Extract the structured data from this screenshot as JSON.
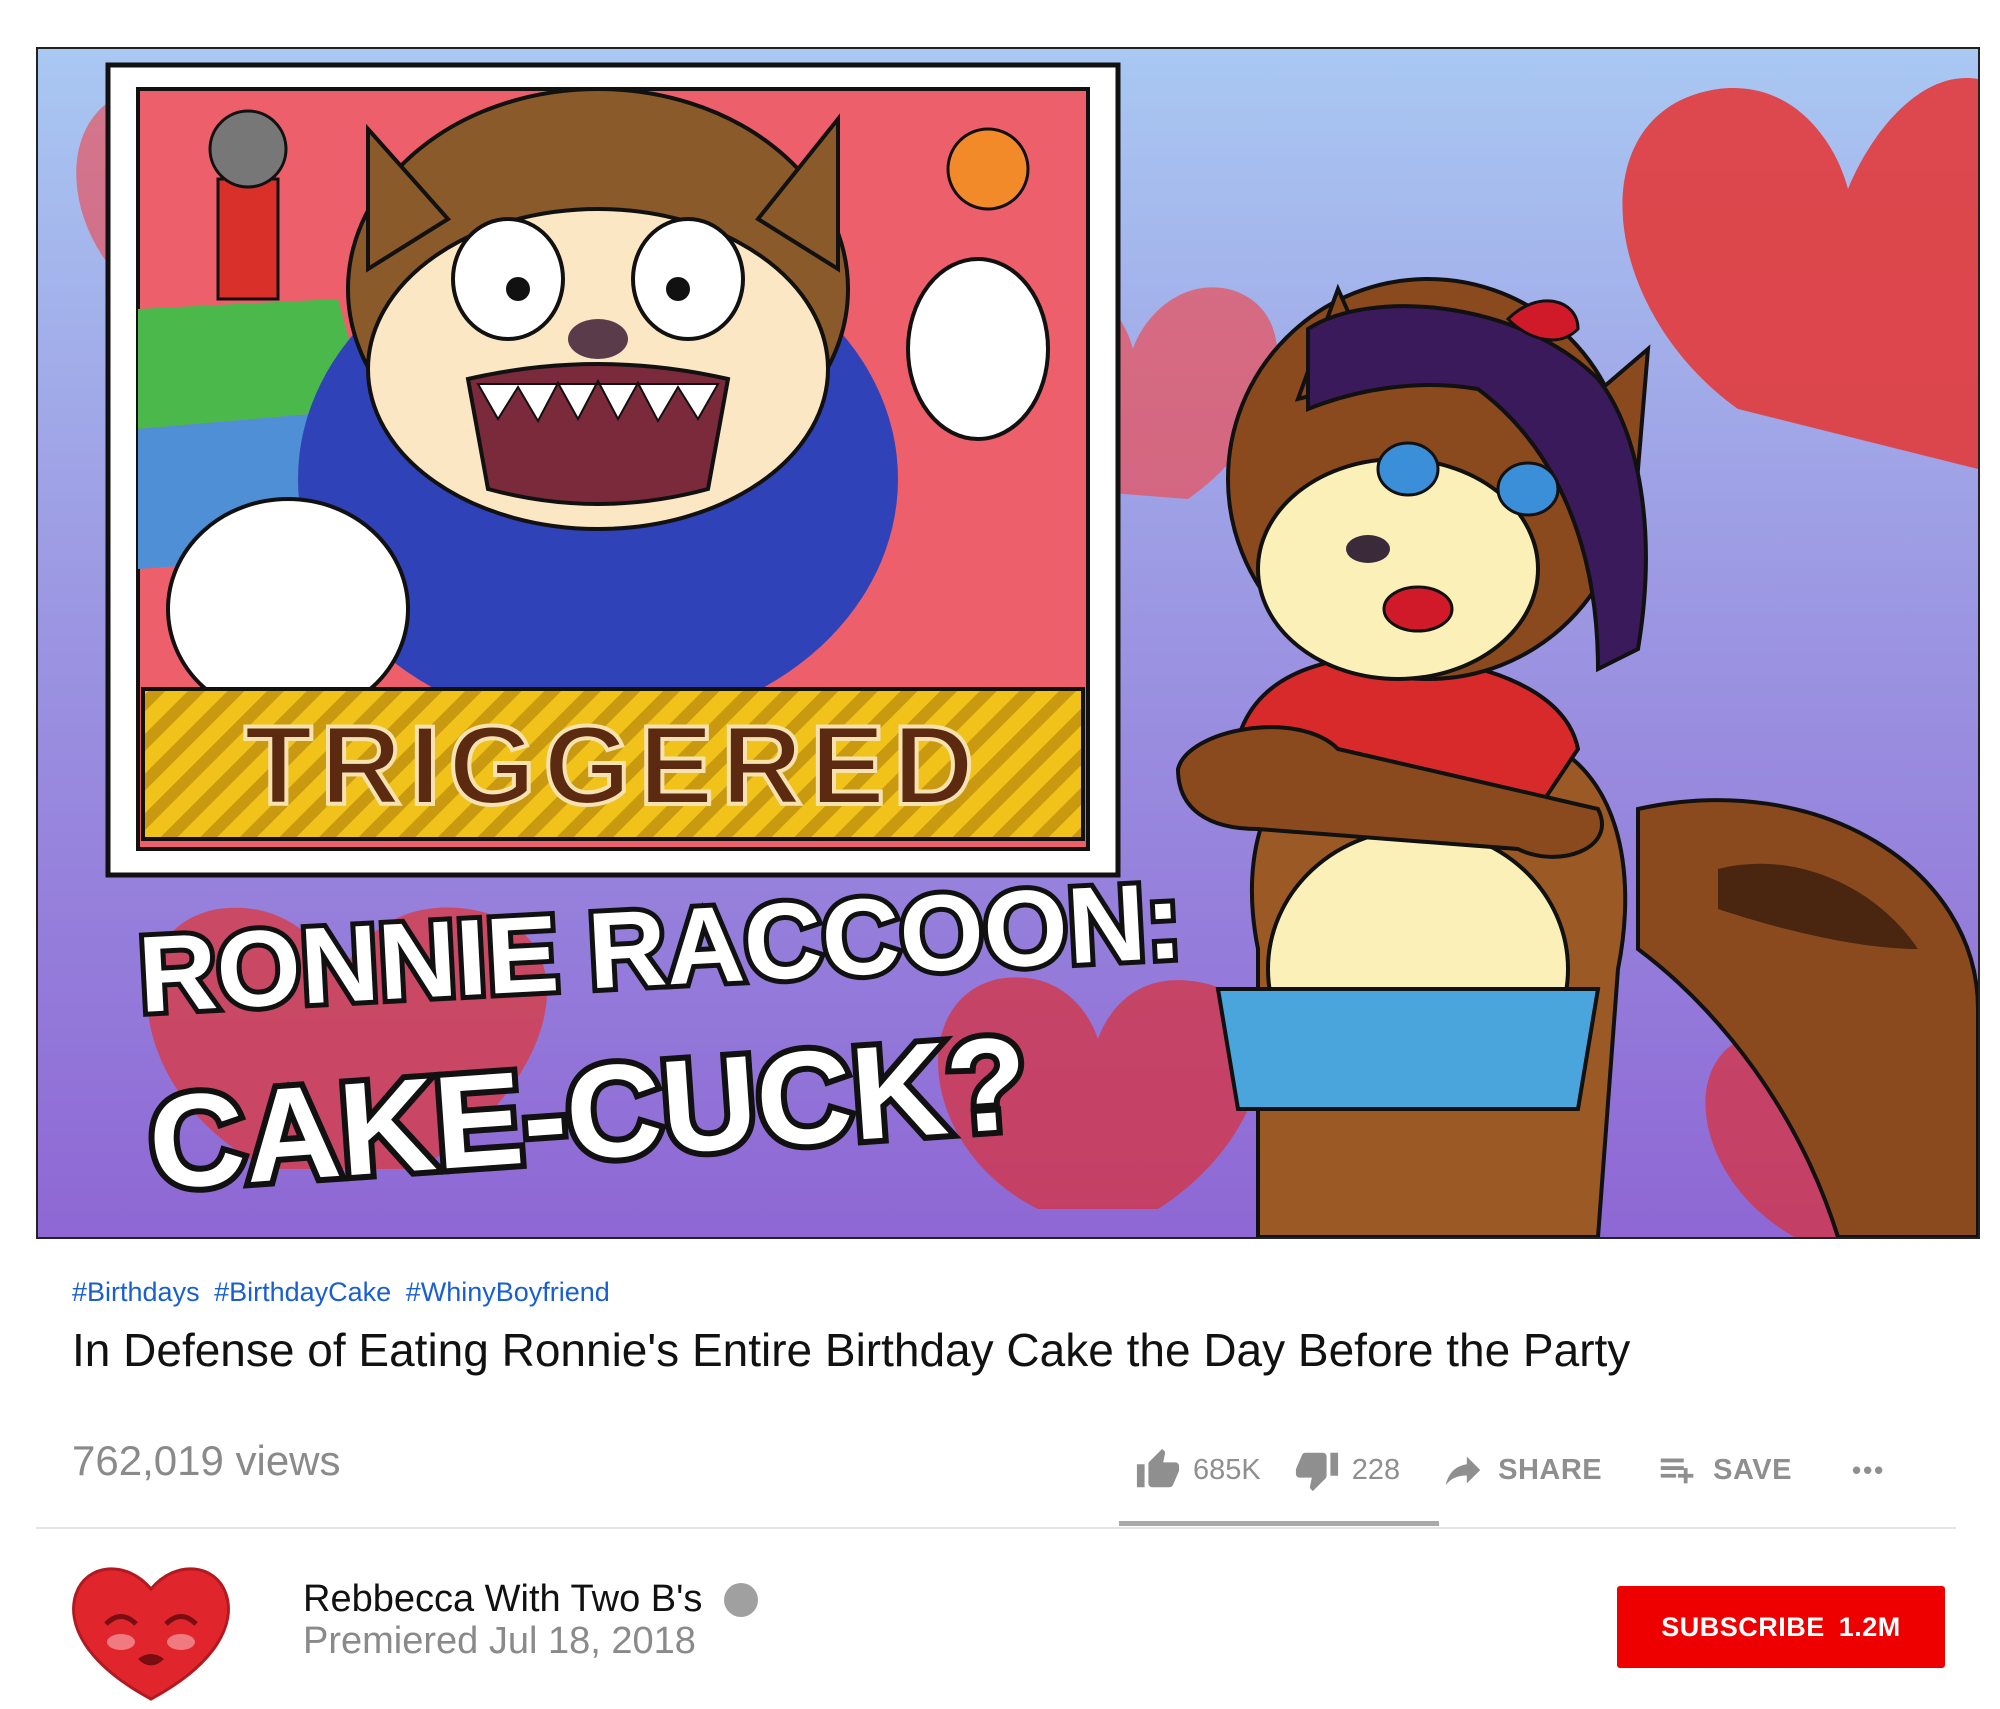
{
  "thumbnail": {
    "badge_text": "TRIGGERED",
    "headline_line1": "RONNIE RACCOON:",
    "headline_line2": "CAKE-CUCK?",
    "colors": {
      "pink": "#ef5b6a",
      "sky_blue": "#9dbef0",
      "purple": "#8f6fd6",
      "heart_red": "#d9242b",
      "badge_yellow": "#f0c21a",
      "badge_brown": "#5b2a10"
    }
  },
  "video": {
    "hashtags": [
      "#Birthdays",
      "#BirthdayCake",
      "#WhinyBoyfriend"
    ],
    "title": "In Defense of Eating Ronnie's Entire Birthday Cake the Day Before the Party",
    "views": "762,019 views"
  },
  "actions": {
    "like_count": "685K",
    "dislike_count": "228",
    "share_label": "SHARE",
    "save_label": "SAVE",
    "more_label": "•••",
    "icons": [
      "thumbs-up-icon",
      "thumbs-down-icon",
      "share-arrow-icon",
      "playlist-add-icon",
      "more-icon"
    ]
  },
  "channel": {
    "name": "Rebbecca With Two B's",
    "premiered": "Premiered Jul 18, 2018",
    "avatar_icon": "heart-face-avatar",
    "verified_icon": "verified-badge-icon"
  },
  "subscribe": {
    "label": "SUBSCRIBE",
    "count": "1.2M",
    "color": "#ee0000"
  }
}
